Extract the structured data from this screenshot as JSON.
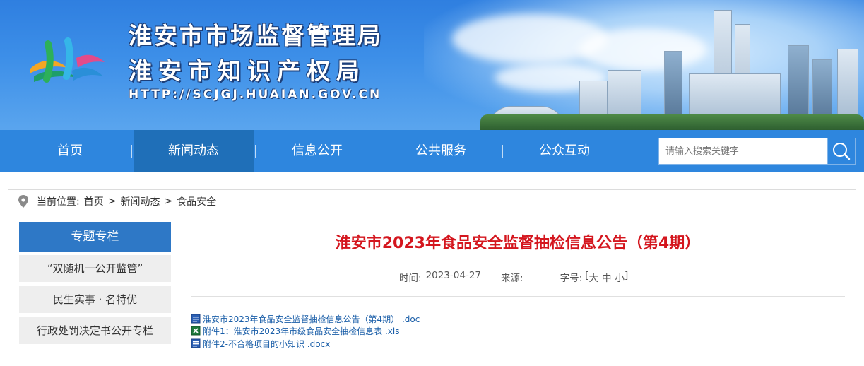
{
  "header": {
    "title_line1": "淮安市市场监督管理局",
    "title_line2": "淮安市知识产权局",
    "url": "HTTP://SCJGJ.HUAIAN.GOV.CN"
  },
  "nav": {
    "items": [
      {
        "label": "首页",
        "active": false
      },
      {
        "label": "新闻动态",
        "active": true
      },
      {
        "label": "信息公开",
        "active": false
      },
      {
        "label": "公共服务",
        "active": false
      },
      {
        "label": "公众互动",
        "active": false
      }
    ],
    "search_placeholder": "请输入搜索关键字"
  },
  "breadcrumb": {
    "prefix": "当前位置:",
    "items": [
      "首页",
      "新闻动态",
      "食品安全"
    ],
    "separator": ">"
  },
  "sidebar": {
    "heading": "专题专栏",
    "items": [
      "“双随机一公开监管”",
      "民生实事 · 名特优",
      "行政处罚决定书公开专栏"
    ]
  },
  "article": {
    "title": "淮安市2023年食品安全监督抽检信息公告（第4期）",
    "time_label": "时间:",
    "time_value": "2023-04-27",
    "source_label": "来源:",
    "source_value": "",
    "fontsize_label": "字号:",
    "fontsize_open": "[",
    "fontsize_large": "大",
    "fontsize_medium": "中",
    "fontsize_small": "小",
    "fontsize_close": "]"
  },
  "attachments": [
    {
      "label": "淮安市2023年食品安全监督抽检信息公告（第4期） .doc",
      "icon": "word-doc-icon"
    },
    {
      "label": "附件1：淮安市2023年市级食品安全抽检信息表 .xls",
      "icon": "excel-xls-icon"
    },
    {
      "label": "附件2-不合格项目的小知识 .docx",
      "icon": "word-docx-icon"
    }
  ],
  "colors": {
    "banner": "#2f7fe0",
    "nav": "#2e86de",
    "nav_active": "#1f6fb8",
    "sidebar_head": "#2e78c6",
    "title_red": "#d4161e",
    "link_blue": "#1a5ea8"
  }
}
